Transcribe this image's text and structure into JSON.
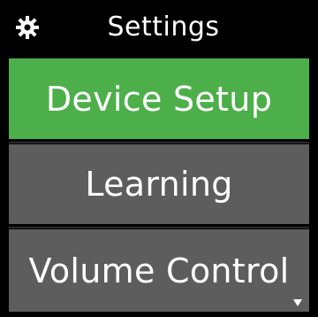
{
  "header": {
    "title": "Settings",
    "icon": "gear-icon"
  },
  "menu": {
    "items": [
      {
        "label": "Device Setup",
        "selected": true
      },
      {
        "label": "Learning",
        "selected": false
      },
      {
        "label": "Volume Control",
        "selected": false
      }
    ]
  },
  "scroll": {
    "icon": "scroll-down-icon"
  },
  "colors": {
    "background": "#000000",
    "selected": "#4daf4a",
    "item": "#5d5d5d",
    "text": "#ffffff"
  }
}
